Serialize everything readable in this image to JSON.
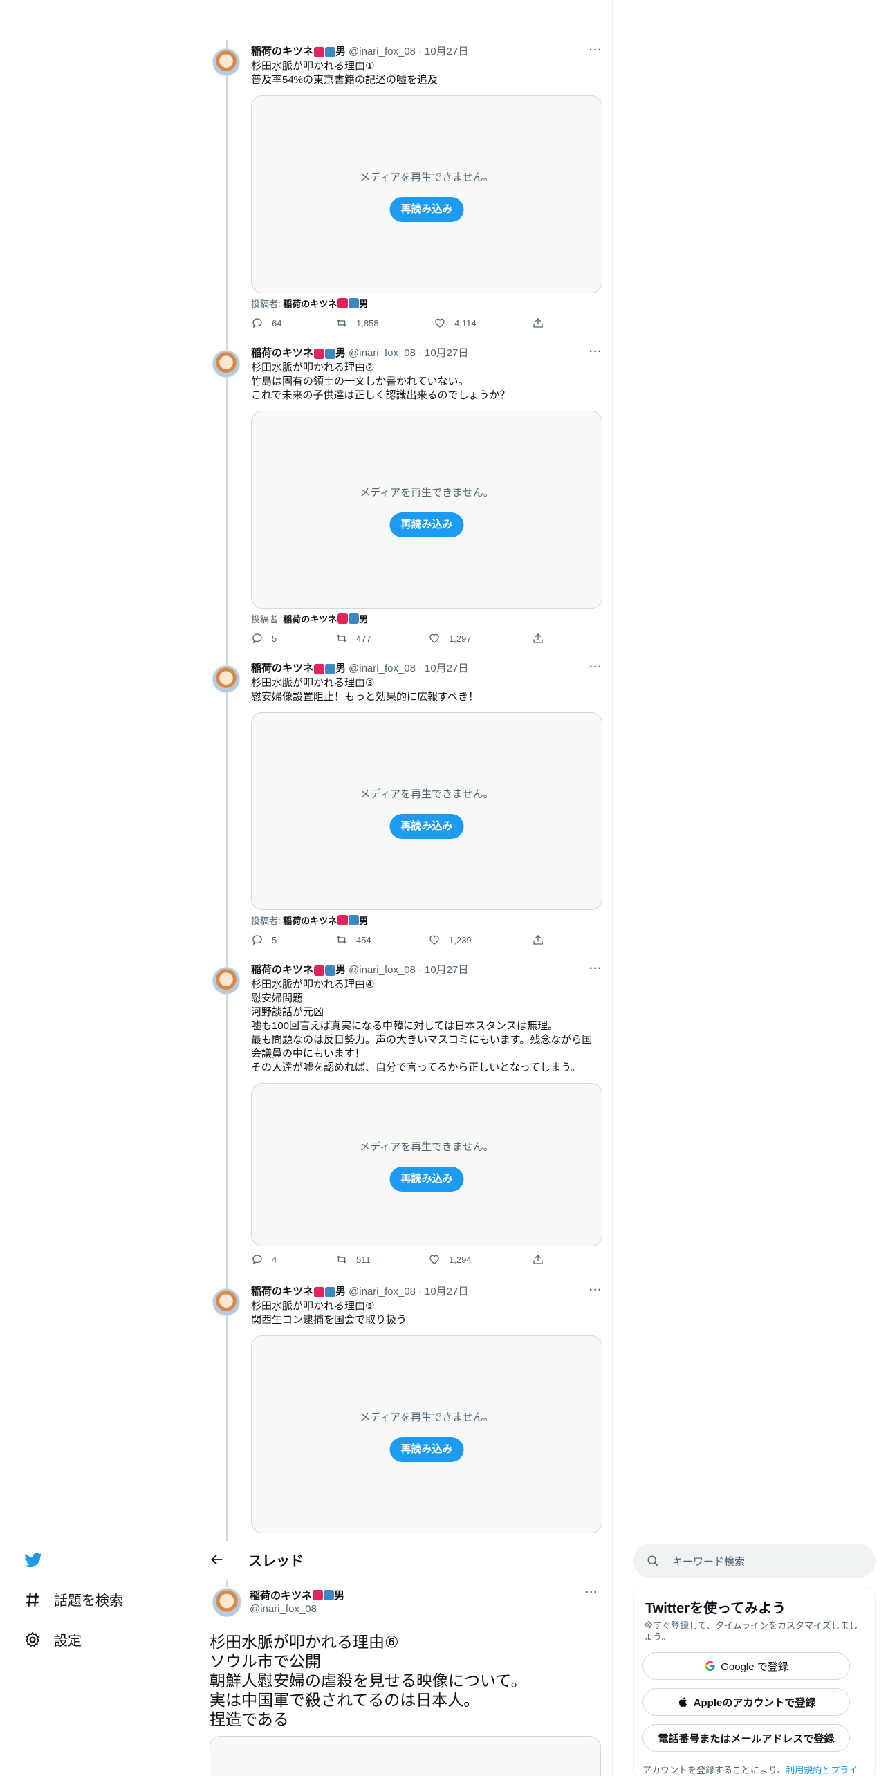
{
  "author": {
    "name": "稲荷のキツネ",
    "name_suffix": "男",
    "handle": "@inari_fox_08",
    "date": "10月27日",
    "separator": "·"
  },
  "media": {
    "error_message": "メディアを再生できません。",
    "reload_label": "再読み込み",
    "poster_prefix": "投稿者:"
  },
  "tweets": [
    {
      "lines": [
        "杉田水脈が叩かれる理由①",
        "普及率54%の東京書籍の記述の嘘を追及"
      ],
      "replies": "64",
      "retweets": "1,858",
      "likes": "4,114"
    },
    {
      "lines": [
        "杉田水脈が叩かれる理由②",
        "竹島は固有の領土の一文しか書かれていない。",
        "これで未来の子供達は正しく認識出来るのでしょうか？"
      ],
      "replies": "5",
      "retweets": "477",
      "likes": "1,297"
    },
    {
      "lines": [
        "杉田水脈が叩かれる理由③",
        "慰安婦像設置阻止！もっと効果的に広報すべき！"
      ],
      "replies": "5",
      "retweets": "454",
      "likes": "1,239"
    },
    {
      "lines": [
        "杉田水脈が叩かれる理由④",
        "慰安婦問題",
        "河野談話が元凶",
        "嘘も100回言えば真実になる中韓に対しては日本スタンスは無理。",
        "最も問題なのは反日勢力。声の大きいマスコミにもいます。残念ながら国",
        "会議員の中にもいます！",
        "その人達が嘘を認めれば、自分で言ってるから正しいとなってしまう。"
      ],
      "replies": "4",
      "retweets": "511",
      "likes": "1,294"
    },
    {
      "lines": [
        "杉田水脈が叩かれる理由⑤",
        "関西生コン逮捕を国会で取り扱う"
      ],
      "replies": "",
      "retweets": "",
      "likes": ""
    }
  ],
  "nav": {
    "explore_label": "話題を検索",
    "settings_label": "設定"
  },
  "thread_header": {
    "title": "スレッド"
  },
  "main_tweet": {
    "lines": [
      "杉田水脈が叩かれる理由⑥",
      "ソウル市で公開",
      "朝鮮人慰安婦の虐殺を見せる映像について。",
      "実は中国軍で殺されてるのは日本人。",
      "捏造である"
    ]
  },
  "search": {
    "placeholder": "キーワード検索"
  },
  "signup": {
    "title": "Twitterを使ってみよう",
    "description": "今すぐ登録して、タイムラインをカスタマイズしましょう。",
    "google_label": "Google で登録",
    "apple_label": "Appleのアカウントで登録",
    "phone_label": "電話番号またはメールアドレスで登録",
    "terms_prefix": "アカウントを登録することにより、",
    "terms_link": "利用規約とプライ"
  },
  "colors": {
    "accent": "#1d9bf0",
    "text": "#0f1419",
    "muted": "#536471",
    "border": "#cfd9de"
  }
}
